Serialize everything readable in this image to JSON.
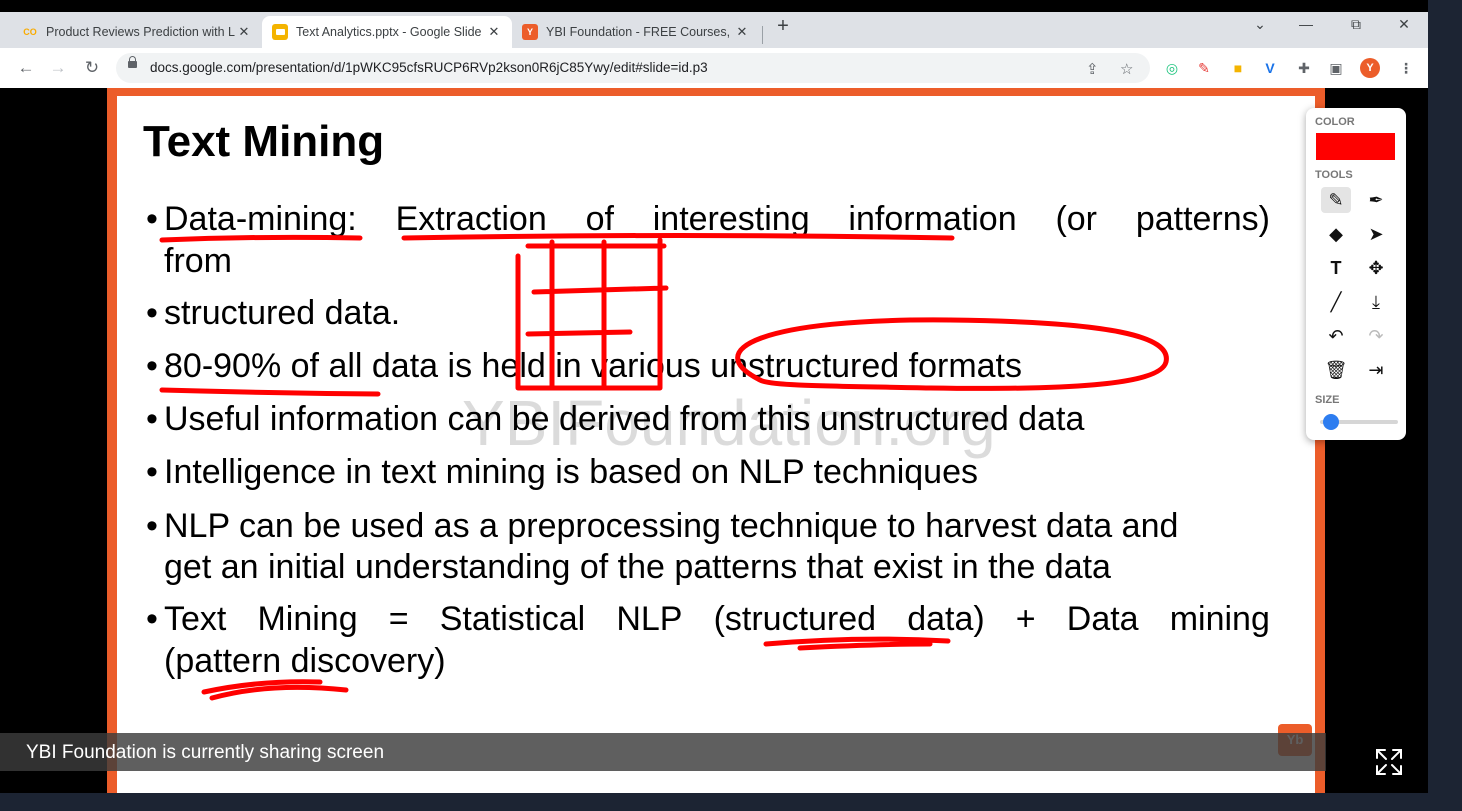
{
  "browser": {
    "tabs": [
      {
        "title": "Product Reviews Prediction with L",
        "favicon": "CO",
        "active": false
      },
      {
        "title": "Text Analytics.pptx - Google Slide",
        "favicon": "slides-icon",
        "active": true
      },
      {
        "title": "YBI Foundation - FREE Courses, Li",
        "favicon": "ybi-icon",
        "active": false
      }
    ],
    "url": "docs.google.com/presentation/d/1pWKC95cfsRUCP6RVp2kson0R6jC85Ywy/edit#slide=id.p3",
    "new_tab": "+",
    "window_controls": {
      "minimize": "—",
      "restore": "⧉",
      "close": "✕",
      "tab_search": "⌄"
    }
  },
  "slide": {
    "title": "Text Mining",
    "watermark": "YBIFoundation.org",
    "bullets": [
      {
        "words": [
          "Data-mining:",
          "Extraction",
          "of",
          "interesting",
          "information",
          "(or",
          "patterns)"
        ],
        "cont": "from"
      },
      {
        "text": "structured data."
      },
      {
        "text": "80-90% of all data is held in various unstructured formats"
      },
      {
        "text": "Useful information can be derived from this unstructured data"
      },
      {
        "text": "Intelligence in text mining is based on NLP techniques"
      },
      {
        "text": "NLP can be used as a preprocessing technique to harvest data and",
        "cont": "get an initial understanding of the patterns that exist in the data"
      },
      {
        "words": [
          "Text",
          "Mining",
          "=",
          "Statistical",
          "NLP",
          "(structured",
          "data)",
          "+",
          "Data",
          "mining"
        ],
        "cont": "(pattern discovery)"
      }
    ],
    "bullet_symbol": "•",
    "corner_logo": "Yb"
  },
  "annotation_toolbox": {
    "color_label": "COLOR",
    "current_color": "#ff0000",
    "tools_label": "TOOLS",
    "size_label": "SIZE",
    "size_value": 0.1,
    "tools": [
      "pen",
      "highlighter",
      "eraser",
      "pointer",
      "text",
      "move",
      "line",
      "download",
      "undo",
      "redo",
      "delete",
      "exit"
    ]
  },
  "share_banner": {
    "text": "YBI Foundation is currently sharing screen"
  },
  "colors": {
    "slide_border": "#ec5d2a",
    "ink": "#ff0000",
    "tab_strip": "#dee1e6",
    "page_bg": "#1c2433"
  }
}
